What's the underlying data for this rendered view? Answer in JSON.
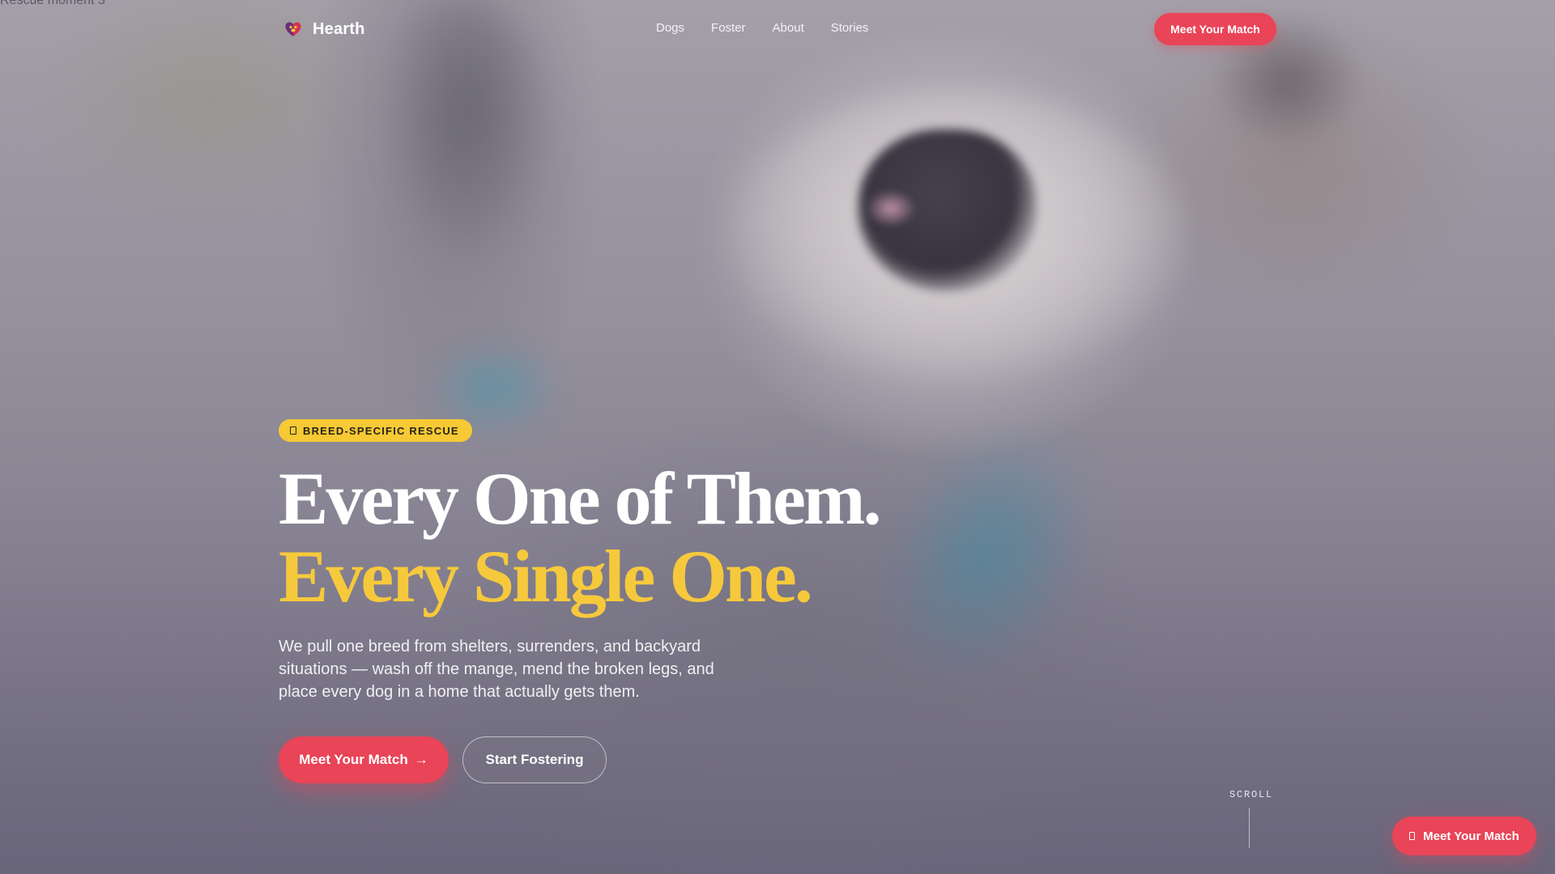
{
  "background": {
    "caption": "Rescue moment 3"
  },
  "nav": {
    "brand": "Hearth",
    "brand_icon": "heart-paw-icon",
    "links": [
      "Dogs",
      "Foster",
      "About",
      "Stories"
    ],
    "cta": "Meet Your Match"
  },
  "hero": {
    "badge_icon": "tag-icon",
    "badge": "BREED-SPECIFIC RESCUE",
    "headline_line1": "Every One of Them.",
    "headline_line2": "Every Single One.",
    "lede": "We pull one breed from shelters, surrenders, and backyard situations — wash off the mange, mend the broken legs, and place every dog in a home that actually gets them.",
    "primary_cta": "Meet Your Match",
    "primary_cta_arrow": "→",
    "secondary_cta": "Start Fostering"
  },
  "scroll_cue": {
    "label": "SCROLL"
  },
  "floating_cta": {
    "icon": "tag-icon",
    "label": "Meet Your Match"
  },
  "colors": {
    "accent": "#e94458",
    "highlight": "#f6c93c",
    "text_light": "#ffffff"
  }
}
